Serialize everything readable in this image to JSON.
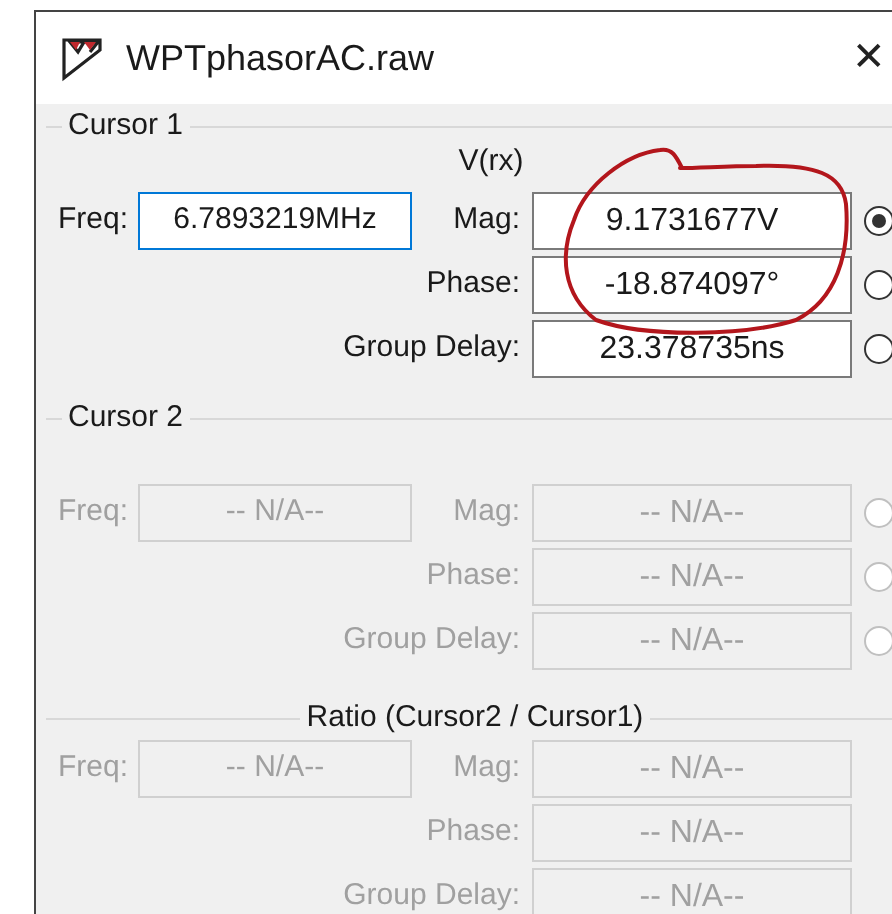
{
  "window": {
    "title": "WPTphasorAC.raw",
    "close": "✕"
  },
  "sections": [
    {
      "kind": "cursor",
      "title": "Cursor 1",
      "trace": "V(rx)",
      "disabled": false,
      "freq_label": "Freq:",
      "freq": {
        "value": "6.7893219MHz",
        "focused": true
      },
      "rows": [
        {
          "label": "Mag:",
          "value": "9.1731677V",
          "selected": true
        },
        {
          "label": "Phase:",
          "value": "-18.874097°",
          "selected": false
        },
        {
          "label": "Group Delay:",
          "value": "23.378735ns",
          "selected": false
        }
      ]
    },
    {
      "kind": "cursor",
      "title": "Cursor 2",
      "disabled": true,
      "freq_label": "Freq:",
      "freq": {
        "value": "-- N/A--",
        "focused": false
      },
      "rows": [
        {
          "label": "Mag:",
          "value": "-- N/A--",
          "selected": false
        },
        {
          "label": "Phase:",
          "value": "-- N/A--",
          "selected": false
        },
        {
          "label": "Group Delay:",
          "value": "-- N/A--",
          "selected": false
        }
      ]
    },
    {
      "kind": "ratio",
      "title": "Ratio (Cursor2 / Cursor1)",
      "disabled": true,
      "freq_label": "Freq:",
      "freq": {
        "value": "-- N/A--",
        "focused": false
      },
      "rows": [
        {
          "label": "Mag:",
          "value": "-- N/A--"
        },
        {
          "label": "Phase:",
          "value": "-- N/A--"
        },
        {
          "label": "Group Delay:",
          "value": "-- N/A--"
        }
      ]
    }
  ]
}
